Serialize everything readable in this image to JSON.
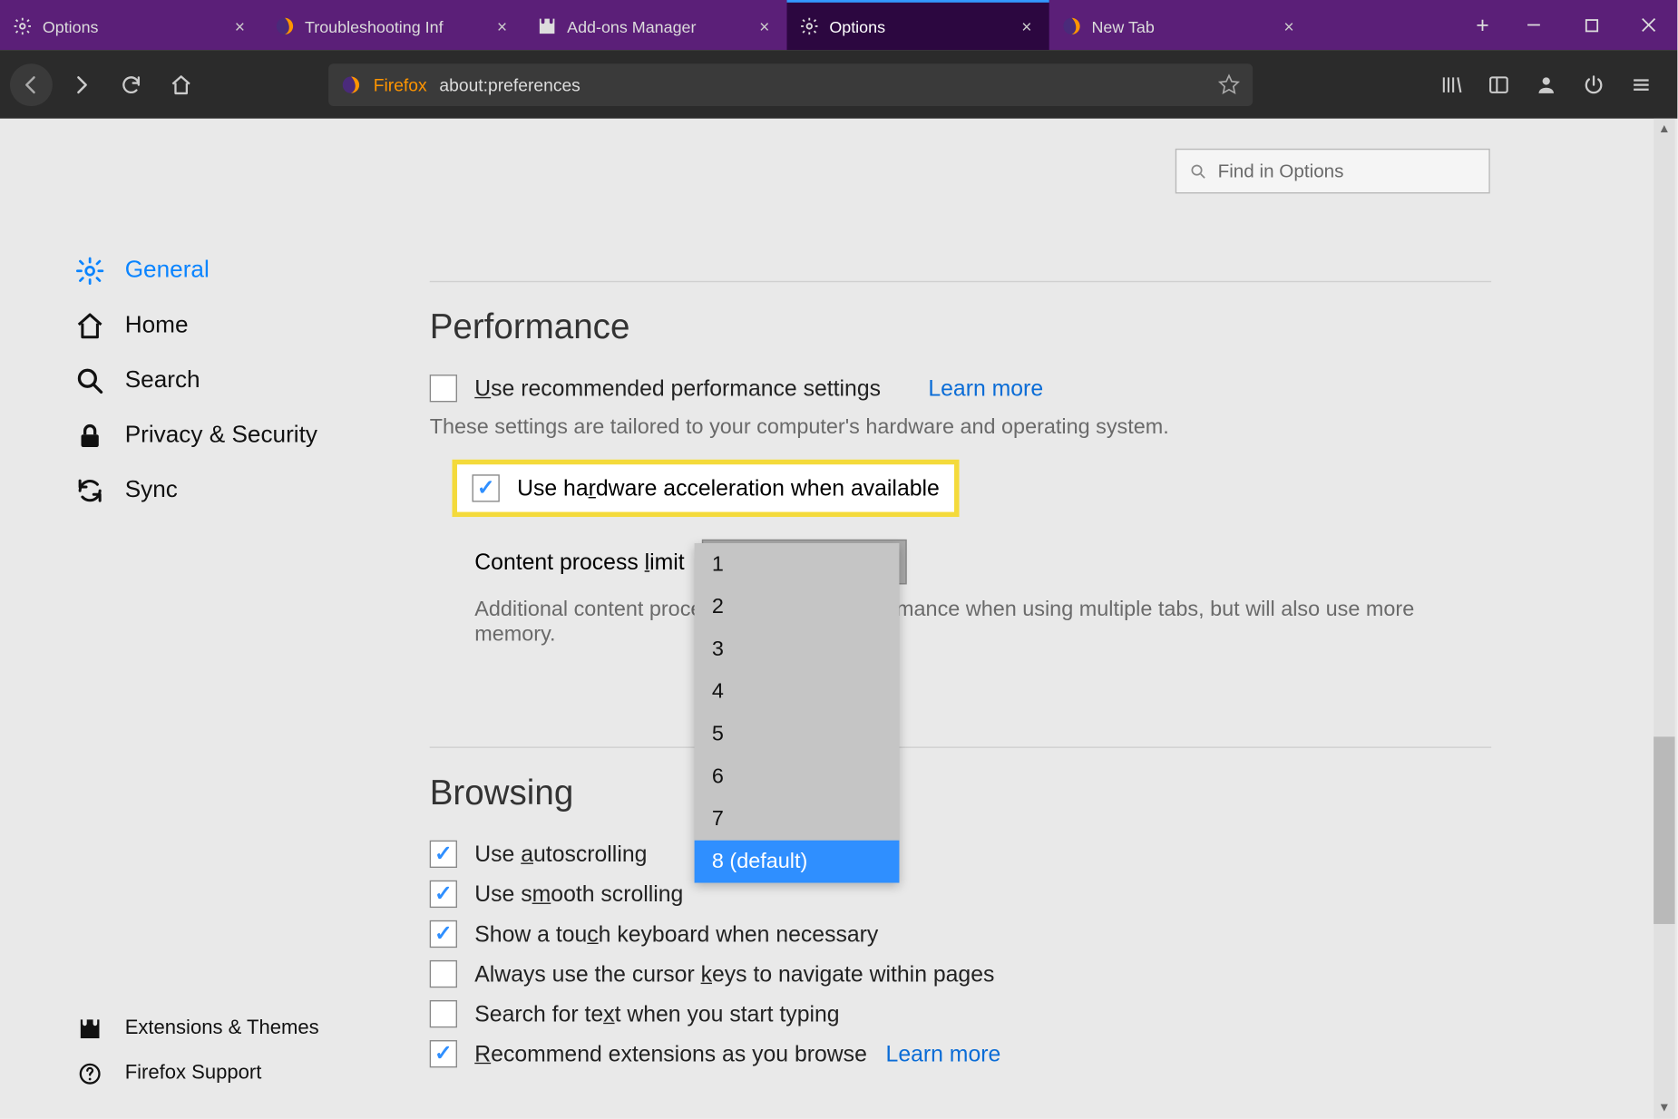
{
  "tabs": [
    {
      "label": "Options",
      "type": "gear"
    },
    {
      "label": "Troubleshooting Inf",
      "type": "ff"
    },
    {
      "label": "Add-ons Manager",
      "type": "puzzle"
    },
    {
      "label": "Options",
      "type": "gear",
      "active": true
    },
    {
      "label": "New Tab",
      "type": "ff"
    }
  ],
  "urlbar": {
    "product": "Firefox",
    "url": "about:preferences"
  },
  "search": {
    "placeholder": "Find in Options"
  },
  "sidebar": {
    "items": [
      {
        "label": "General"
      },
      {
        "label": "Home"
      },
      {
        "label": "Search"
      },
      {
        "label": "Privacy & Security"
      },
      {
        "label": "Sync"
      }
    ],
    "bottom": [
      {
        "label": "Extensions & Themes"
      },
      {
        "label": "Firefox Support"
      }
    ]
  },
  "performance": {
    "heading": "Performance",
    "recommended_pre": "U",
    "recommended_rest": "se recommended performance settings",
    "learn_more": "Learn more",
    "tailored": "These settings are tailored to your computer's hardware and operating system.",
    "hw_pre": "Use ha",
    "hw_u": "r",
    "hw_post": "dware acceleration when available",
    "cpl_pre": "Content process ",
    "cpl_u": "l",
    "cpl_post": "imit",
    "cpl_value": "8 (default)",
    "cpl_options": [
      "1",
      "2",
      "3",
      "4",
      "5",
      "6",
      "7",
      "8 (default)"
    ],
    "additional_a": "Additional content proce",
    "additional_b": "ormance when using multiple tabs, but will also use more memory."
  },
  "browsing": {
    "heading": "Browsing",
    "items": [
      {
        "checked": true,
        "pre": "Use ",
        "u": "a",
        "post": "utoscrolling"
      },
      {
        "checked": true,
        "pre": "Use s",
        "u": "m",
        "post": "ooth scrolling"
      },
      {
        "checked": true,
        "pre": "Show a tou",
        "u": "c",
        "post": "h keyboard when necessary"
      },
      {
        "checked": false,
        "pre": "Always use the cursor ",
        "u": "k",
        "post": "eys to navigate within pages"
      },
      {
        "checked": false,
        "pre": "Search for te",
        "u": "x",
        "post": "t when you start typing"
      },
      {
        "checked": true,
        "pre": "",
        "u": "R",
        "post": "ecommend extensions as you browse",
        "link": "Learn more"
      }
    ]
  }
}
